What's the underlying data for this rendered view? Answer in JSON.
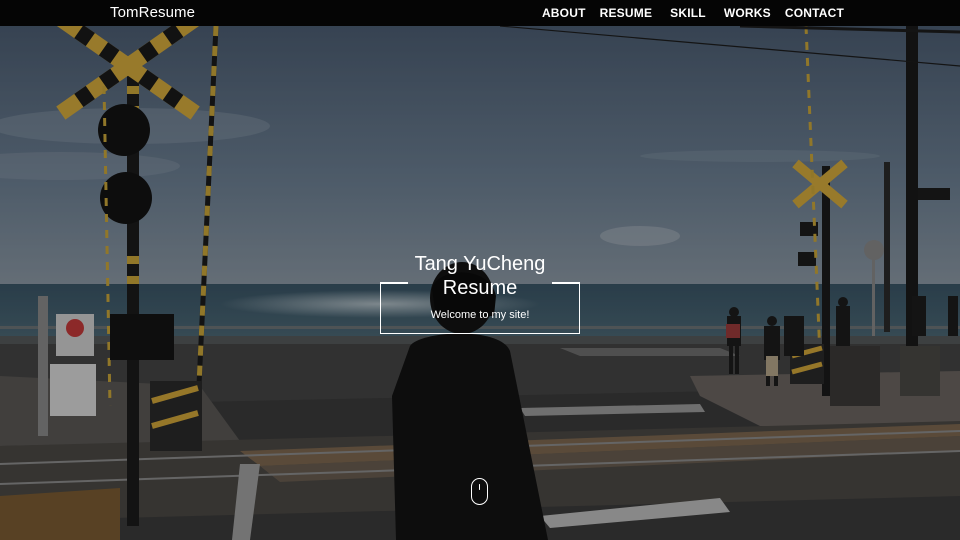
{
  "navbar": {
    "brand": "TomResume",
    "links": [
      {
        "label": "ABOUT"
      },
      {
        "label": "RESUME"
      },
      {
        "label": "SKILL"
      },
      {
        "label": "WORKS"
      },
      {
        "label": "CONTACT"
      }
    ]
  },
  "hero": {
    "title_line1": "Tang YuCheng",
    "title_line2": "Resume",
    "subtitle": "Welcome to my site!",
    "scroll_icon": "mouse-scroll-icon"
  },
  "colors": {
    "navbar_bg": "#050505",
    "text": "#ffffff",
    "sky": "#5f7187",
    "sea": "#3f5868",
    "road": "#3a3a3a"
  }
}
